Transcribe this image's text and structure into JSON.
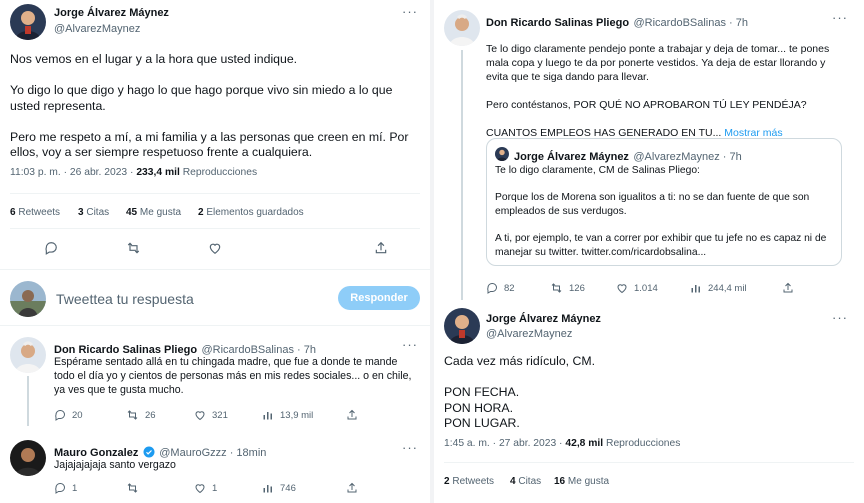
{
  "left": {
    "main": {
      "name": "Jorge Álvarez Máynez",
      "handle": "@AlvarezMaynez",
      "more": "···",
      "text": "Nos vemos en el lugar y a la hora que usted indique.\n\nYo digo lo que digo y hago lo que hago porque vivo sin miedo a lo que usted representa.\n\nPero me respeto a mí, a mi familia y a las personas que creen en mí. Por ellos, voy a ser siempre respetuoso frente a cualquiera.",
      "time": "11:03 p. m. · 26 abr. 2023 · ",
      "views_count": "233,4 mil",
      "views_label": " Reproducciones",
      "stats": [
        {
          "count": "6",
          "label": "Retweets"
        },
        {
          "count": "3",
          "label": "Citas"
        },
        {
          "count": "45",
          "label": "Me gusta"
        },
        {
          "count": "2",
          "label": "Elementos guardados"
        }
      ]
    },
    "compose": {
      "placeholder": "Tweettea tu respuesta",
      "button": "Responder"
    },
    "reply1": {
      "name": "Don Ricardo Salinas Pliego",
      "handle": "@RicardoBSalinas · 7h",
      "more": "···",
      "text": "Espérame sentado allá en tu chingada madre, que fue a donde te mande todo el día yo y cientos de personas más en mis redes sociales... o en chile, ya ves que te gusta mucho.",
      "actions": {
        "replies": "20",
        "retweets": "26",
        "likes": "321",
        "views": "13,9 mil"
      }
    },
    "reply2": {
      "name": "Mauro Gonzalez",
      "handle": "@MauroGzzz · 18min",
      "more": "···",
      "text": "Jajajajajaja santo vergazo",
      "actions": {
        "replies": "1",
        "retweets": "",
        "likes": "1",
        "views": "746"
      }
    }
  },
  "right": {
    "top": {
      "name": "Don Ricardo Salinas Pliego",
      "handle": "@RicardoBSalinas · 7h",
      "more": "···",
      "text": "Te lo digo claramente pendejo ponte a trabajar y deja de tomar... te pones mala copa y luego te da por ponerte vestidos. Ya deja de estar llorando y evita que te siga dando para llevar.\n\nPero contéstanos, POR QUÉ NO APROBARON TÚ LEY PENDÉJA?\n\nCUANTOS EMPLEOS HAS GENERADO EN TU...",
      "show_more": "Mostrar más",
      "quote": {
        "name": "Jorge Álvarez Máynez",
        "handle": "@AlvarezMaynez · 7h",
        "text": "Te lo digo claramente, CM de Salinas Pliego:\n\nPorque los de Morena son igualitos a ti: no se dan fuente de que son empleados de sus verdugos.\n\nA ti, por ejemplo, te van a correr por exhibir que tu jefe no es capaz ni de manejar su twitter. twitter.com/ricardobsalina..."
      },
      "actions": {
        "replies": "82",
        "retweets": "126",
        "likes": "1.014",
        "views": "244,4 mil"
      }
    },
    "main": {
      "name": "Jorge Álvarez Máynez",
      "handle": "@AlvarezMaynez",
      "more": "···",
      "text": "Cada vez más ridículo, CM.\n\nPON FECHA.\nPON HORA.\nPON LUGAR.",
      "time": "1:45 a. m. · 27 abr. 2023 · ",
      "views_count": "42,8 mil",
      "views_label": " Reproducciones",
      "stats": [
        {
          "count": "2",
          "label": "Retweets"
        },
        {
          "count": "4",
          "label": "Citas"
        },
        {
          "count": "16",
          "label": "Me gusta"
        }
      ]
    }
  },
  "colors": {
    "accent": "#1d9bf0",
    "text": "#0f1419",
    "muted": "#536471",
    "border": "#eff3f4"
  }
}
